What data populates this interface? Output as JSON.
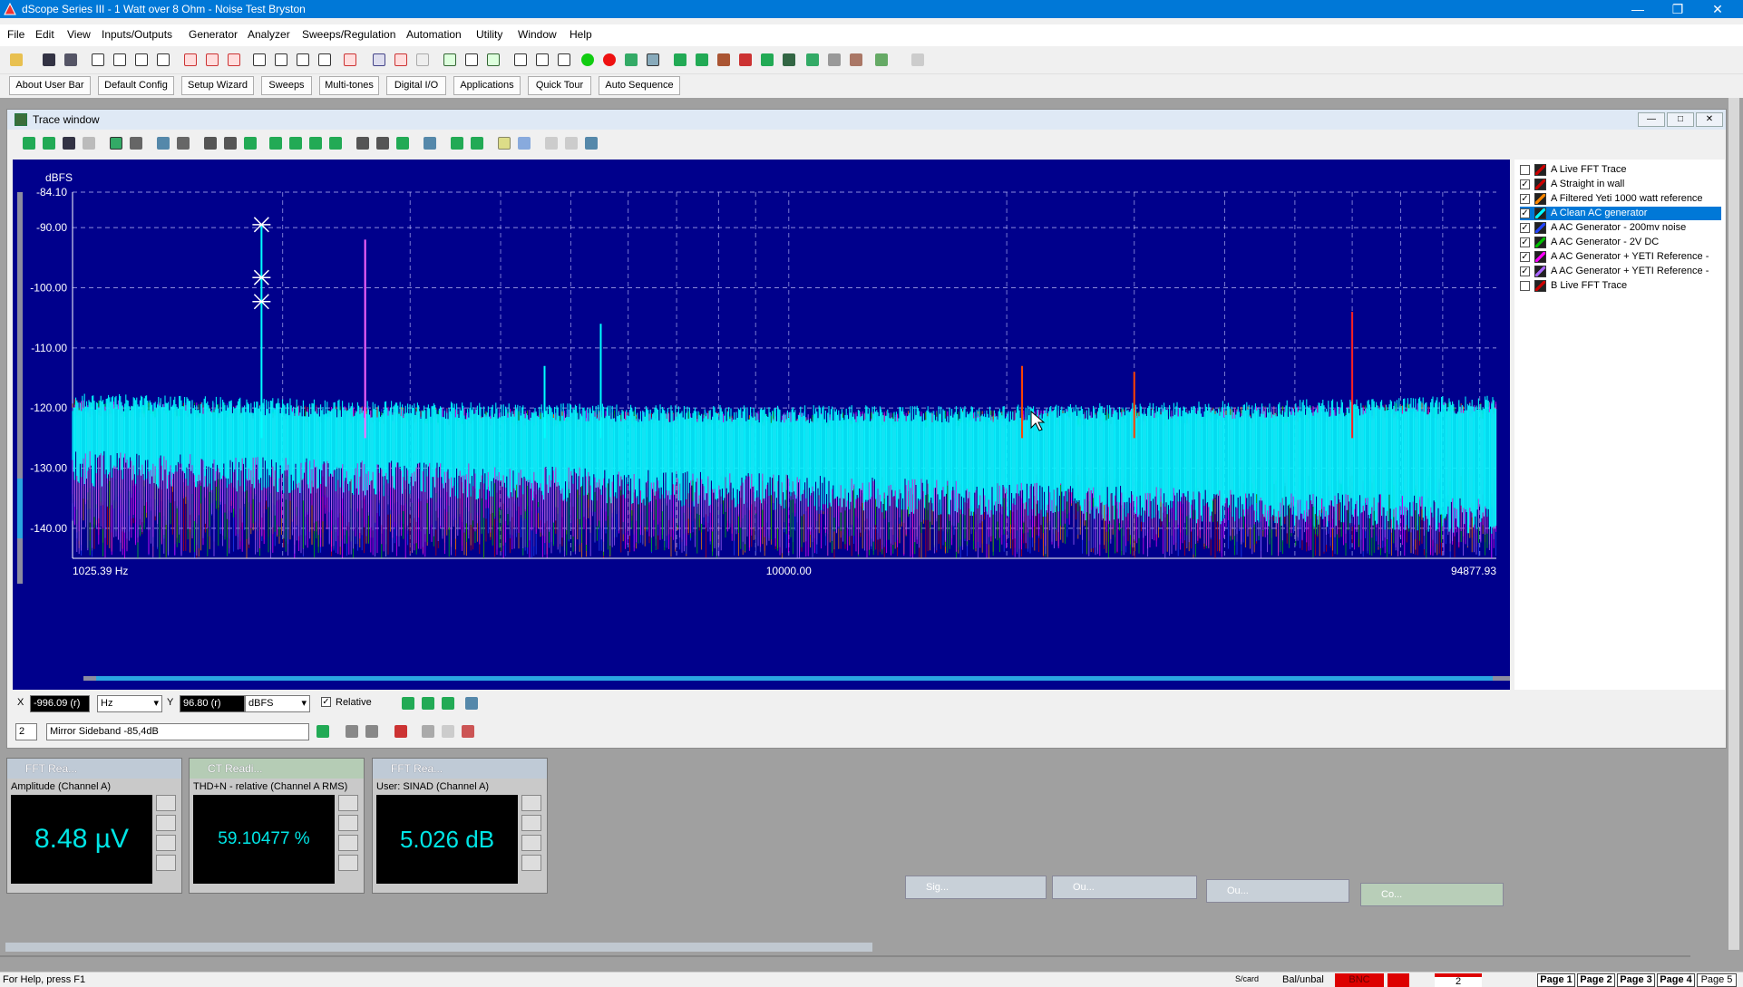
{
  "window": {
    "title": "dScope Series III - 1 Watt over 8 Ohm - Noise Test Bryston"
  },
  "menu": [
    "File",
    "Edit",
    "View",
    "Inputs/Outputs",
    "Generator",
    "Analyzer",
    "Sweeps/Regulation",
    "Automation",
    "Utility",
    "Window",
    "Help"
  ],
  "user_bar": [
    "About User Bar",
    "Default Config",
    "Setup Wizard",
    "Sweeps",
    "Multi-tones",
    "Digital I/O",
    "Applications",
    "Quick Tour",
    "Auto Sequence"
  ],
  "trace_window": {
    "title": "Trace window"
  },
  "chart_data": {
    "type": "line",
    "ylabel": "dBFS",
    "y_ticks": [
      "-84.10",
      "-90.00",
      "-100.00",
      "-110.00",
      "-120.00",
      "-130.00",
      "-140.00"
    ],
    "x_ticks": [
      "1025.39 Hz",
      "10000.00",
      "94877.93"
    ],
    "x_scale": "log",
    "xlim": [
      1025.39,
      94877.93
    ],
    "ylim": [
      -145,
      -84.1
    ],
    "grid": true,
    "noise_floor_dbfs": [
      -145,
      -118
    ],
    "peaks": [
      {
        "x": 1870,
        "y": -89.5
      },
      {
        "x": 2600,
        "y": -92
      },
      {
        "x": 4600,
        "y": -113
      },
      {
        "x": 5500,
        "y": -106
      },
      {
        "x": 21000,
        "y": -113
      },
      {
        "x": 30000,
        "y": -114
      },
      {
        "x": 60000,
        "y": -104
      }
    ],
    "markers": [
      {
        "x": 1870,
        "y": -89.5
      },
      {
        "x": 1870,
        "y": -98.3
      },
      {
        "x": 1870,
        "y": -102.3
      }
    ]
  },
  "legend": [
    {
      "label": "A  Live FFT Trace",
      "checked": false,
      "selected": false,
      "color": "#cc0000"
    },
    {
      "label": "A  Straight in wall",
      "checked": true,
      "selected": false,
      "color": "#cc0000"
    },
    {
      "label": "A  Filtered Yeti 1000 watt reference",
      "checked": true,
      "selected": false,
      "color": "#ff8800"
    },
    {
      "label": "A  Clean AC generator",
      "checked": true,
      "selected": true,
      "color": "#00ffff"
    },
    {
      "label": "A   AC Generator - 200mv noise",
      "checked": true,
      "selected": false,
      "color": "#2244ff"
    },
    {
      "label": "A  AC Generator - 2V DC",
      "checked": true,
      "selected": false,
      "color": "#00c000"
    },
    {
      "label": "A  AC Generator + YETI Reference -",
      "checked": true,
      "selected": false,
      "color": "#ff00ff"
    },
    {
      "label": "A  AC Generator + YETI Reference -",
      "checked": true,
      "selected": false,
      "color": "#aa66ff"
    },
    {
      "label": "B  Live FFT Trace",
      "checked": false,
      "selected": false,
      "color": "#cc0000"
    }
  ],
  "readout": {
    "x_label": "X",
    "x_value": "-996.09 (r)",
    "x_unit": "Hz",
    "y_label": "Y",
    "y_value": "96.80 (r)",
    "y_unit": "dBFS",
    "relative_label": "Relative",
    "marker_num": "2",
    "marker_name": "Mirror Sideband -85,4dB"
  },
  "meters": [
    {
      "title": "FFT Rea...",
      "label": "Amplitude (Channel A)",
      "value": "8.48 µV"
    },
    {
      "title": "CT Readi...",
      "label": "THD+N - relative (Channel A RMS)",
      "value": "59.10477 %"
    },
    {
      "title": "FFT Rea...",
      "label": "User: SINAD (Channel A)",
      "value": "5.026 dB"
    }
  ],
  "minimized": [
    "Sig...",
    "Ou...",
    "Ou...",
    "Co..."
  ],
  "status": {
    "help": "For Help, press F1",
    "pages": [
      "Page 1",
      "Page 2",
      "Page 3",
      "Page 4",
      "Page 5"
    ],
    "balun": "Bal/unbal",
    "bnc": "BNC",
    "channel": "2",
    "scard": "S/card"
  }
}
